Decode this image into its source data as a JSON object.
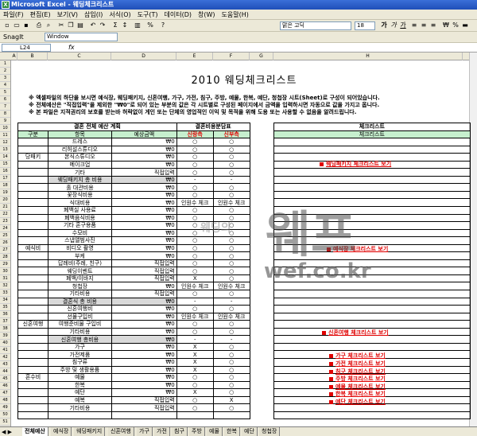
{
  "app": {
    "title": "Microsoft Excel - 웨딩체크리스트",
    "icon": "excel-icon"
  },
  "menu": [
    "파일(F)",
    "편집(E)",
    "보기(V)",
    "삽입(I)",
    "서식(O)",
    "도구(T)",
    "데이터(D)",
    "창(W)",
    "도움말(H)"
  ],
  "toolbar": {
    "font_name": "맑은 고딕",
    "font_size": "18",
    "snagit": "SnagIt",
    "window_label": "Window"
  },
  "formula": {
    "cell_ref": "L24",
    "fx": "fx",
    "value": ""
  },
  "sheet": {
    "title": "2010 웨딩체크리스트",
    "notes": [
      "※ 엑셀파일의 하단을 보시면 예식장, 웨딩패키지, 신혼여행, 가구, 가전, 침구, 주방, 예물, 한복, 예단, 청첩장 시트(Sheet)로 구성이 되어있습니다.",
      "※ 전체예산은 \"직접입력\"을 제외한 \"₩0\"로 되어 있는 부분의 값은 각 시트별로 구성된 페이지에서 금액을 입력하시면 자동으로 값을 가지고 옵니다.",
      "※ 본 파일은 지적권리의 보호를 받는바 허락없이 게인 또는 단체의 영업적인 이익 및 목적을 위해 도용 또는 사용할 수 없음을 알려드립니다."
    ],
    "header": {
      "budget": "결혼 전체 예산 계획",
      "status": "결혼비용분담표",
      "check": "체크리스트"
    },
    "subheader": {
      "cat": "구분",
      "item": "항목",
      "amount": "예상금액",
      "groom": "신랑측",
      "bride": "신부측",
      "check": "체크리스트"
    },
    "rows": [
      {
        "cat": "",
        "item": "드레스",
        "amount": "₩0",
        "g": "○",
        "b": "○",
        "style": ""
      },
      {
        "cat": "",
        "item": "리허설스튜디오",
        "amount": "₩0",
        "g": "○",
        "b": "○",
        "style": ""
      },
      {
        "cat": "당패키",
        "item": "본식스튜디오",
        "amount": "₩0",
        "g": "○",
        "b": "○",
        "style": ""
      },
      {
        "cat": "",
        "item": "메이크업",
        "amount": "₩0",
        "g": "○",
        "b": "○",
        "style": ""
      },
      {
        "cat": "",
        "item": "기타",
        "amount": "직접입력",
        "g": "○",
        "b": "○",
        "style": ""
      },
      {
        "cat": "",
        "item": "웨딩패키지 총 비용",
        "amount": "₩0",
        "g": "-",
        "b": "-",
        "style": "gray"
      },
      {
        "cat": "",
        "item": "홀 대관비용",
        "amount": "₩0",
        "g": "○",
        "b": "○",
        "style": ""
      },
      {
        "cat": "",
        "item": "꽃장식비용",
        "amount": "₩0",
        "g": "○",
        "b": "○",
        "style": ""
      },
      {
        "cat": "",
        "item": "식대비용",
        "amount": "₩0",
        "g": "인원수 체크",
        "b": "인원수 체크",
        "style": ""
      },
      {
        "cat": "",
        "item": "폐백실 사용료",
        "amount": "₩0",
        "g": "○",
        "b": "○",
        "style": ""
      },
      {
        "cat": "",
        "item": "폐백음식비용",
        "amount": "₩0",
        "g": "○",
        "b": "○",
        "style": ""
      },
      {
        "cat": "",
        "item": "기타 혼구용품",
        "amount": "₩0",
        "g": "○",
        "b": "○",
        "style": ""
      },
      {
        "cat": "",
        "item": "수모비",
        "amount": "₩0",
        "g": "○",
        "b": "○",
        "style": ""
      },
      {
        "cat": "",
        "item": "스냅앨범사진",
        "amount": "₩0",
        "g": "○",
        "b": "○",
        "style": ""
      },
      {
        "cat": "예식비",
        "item": "비디오 촬영",
        "amount": "₩0",
        "g": "○",
        "b": "○",
        "style": ""
      },
      {
        "cat": "",
        "item": "부케",
        "amount": "₩0",
        "g": "○",
        "b": "○",
        "style": ""
      },
      {
        "cat": "",
        "item": "답례비(주례, 친구)",
        "amount": "직접입력",
        "g": "○",
        "b": "○",
        "style": ""
      },
      {
        "cat": "",
        "item": "웨딩이벤트",
        "amount": "직접입력",
        "g": "○",
        "b": "○",
        "style": ""
      },
      {
        "cat": "",
        "item": "폐백/이바지",
        "amount": "직접입력",
        "g": "X",
        "b": "○",
        "style": ""
      },
      {
        "cat": "",
        "item": "청첩장",
        "amount": "₩0",
        "g": "인원수 체크",
        "b": "인원수 체크",
        "style": ""
      },
      {
        "cat": "",
        "item": "기타비용",
        "amount": "직접입력",
        "g": "○",
        "b": "○",
        "style": ""
      },
      {
        "cat": "",
        "item": "결혼식 총 비용",
        "amount": "₩0",
        "g": "-",
        "b": "-",
        "style": "gray"
      },
      {
        "cat": "",
        "item": "신혼여행비",
        "amount": "₩0",
        "g": "○",
        "b": "○",
        "style": ""
      },
      {
        "cat": "",
        "item": "선물구입비",
        "amount": "₩0",
        "g": "인원수 체크",
        "b": "인원수 체크",
        "style": ""
      },
      {
        "cat": "신혼여행",
        "item": "여행준비물 구입비",
        "amount": "₩0",
        "g": "○",
        "b": "○",
        "style": ""
      },
      {
        "cat": "",
        "item": "기타비용",
        "amount": "₩0",
        "g": "○",
        "b": "○",
        "style": ""
      },
      {
        "cat": "",
        "item": "신혼여행 총비용",
        "amount": "₩0",
        "g": "-",
        "b": "-",
        "style": "gray"
      },
      {
        "cat": "",
        "item": "가구",
        "amount": "₩0",
        "g": "X",
        "b": "○",
        "style": ""
      },
      {
        "cat": "",
        "item": "가전제품",
        "amount": "₩0",
        "g": "X",
        "b": "○",
        "style": ""
      },
      {
        "cat": "",
        "item": "침구류",
        "amount": "₩0",
        "g": "X",
        "b": "○",
        "style": ""
      },
      {
        "cat": "",
        "item": "주방 및 생활용품",
        "amount": "₩0",
        "g": "X",
        "b": "○",
        "style": ""
      },
      {
        "cat": "혼수비",
        "item": "예물",
        "amount": "₩0",
        "g": "○",
        "b": "○",
        "style": ""
      },
      {
        "cat": "",
        "item": "한복",
        "amount": "₩0",
        "g": "○",
        "b": "○",
        "style": ""
      },
      {
        "cat": "",
        "item": "예단",
        "amount": "₩0",
        "g": "X",
        "b": "○",
        "style": ""
      },
      {
        "cat": "",
        "item": "예복",
        "amount": "직접입력",
        "g": "○",
        "b": "X",
        "style": ""
      },
      {
        "cat": "",
        "item": "기타비용",
        "amount": "직접입력",
        "g": "○",
        "b": "○",
        "style": ""
      },
      {
        "cat": "",
        "item": "",
        "amount": "",
        "g": "",
        "b": "",
        "style": ""
      }
    ],
    "links": [
      {
        "label": "웨딩패키지 체크리스트 보기"
      },
      {
        "label": "예식장 체크리스트 보기"
      },
      {
        "label": "신혼여행 체크리스트 보기"
      },
      {
        "label": "가구 체크리스트 보기"
      },
      {
        "label": "가전 체크리스트 보기"
      },
      {
        "label": "침구 체크리스트 보기"
      },
      {
        "label": "주방 체크리스트 보기"
      },
      {
        "label": "예물 체크리스트 보기"
      },
      {
        "label": "한복 체크리스트 보기"
      },
      {
        "label": "예단 체크리스트 보기"
      }
    ],
    "watermark": {
      "small": "웨딩의",
      "brand": "웨프",
      "url": "wef.co.kr"
    }
  },
  "tabs": [
    "전체예산",
    "예식장",
    "웨딩패키지",
    "신혼여행",
    "가구",
    "가전",
    "침구",
    "주방",
    "예물",
    "한복",
    "예단",
    "청첩장"
  ]
}
